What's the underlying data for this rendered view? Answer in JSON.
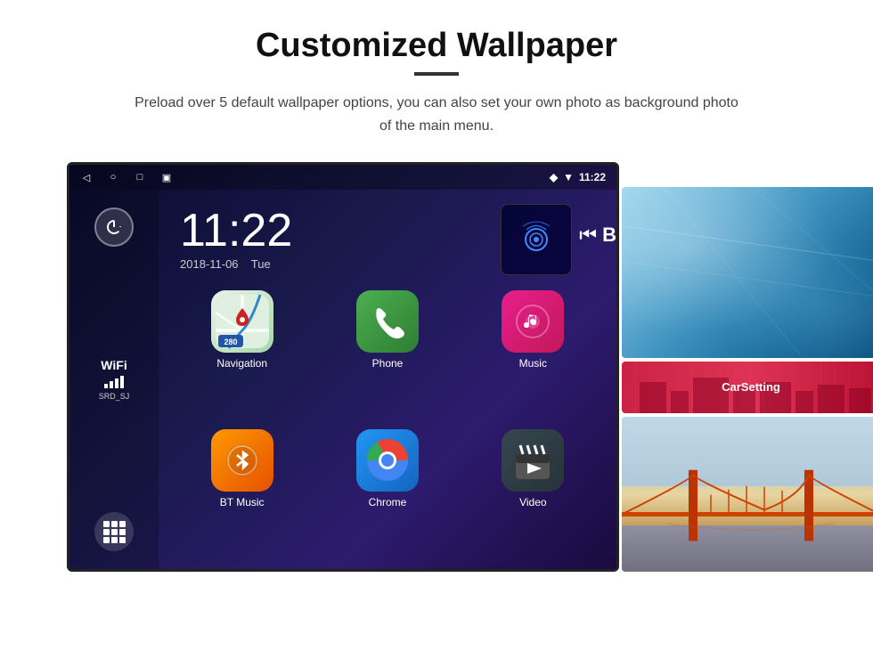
{
  "header": {
    "title": "Customized Wallpaper",
    "subtitle": "Preload over 5 default wallpaper options, you can also set your own photo as background photo of the main menu."
  },
  "status_bar": {
    "time": "11:22",
    "wifi_icon": "wifi",
    "nav_icon": "location"
  },
  "clock": {
    "time": "11:22",
    "date": "2018-11-06",
    "day": "Tue"
  },
  "wifi": {
    "label": "WiFi",
    "ssid": "SRD_SJ"
  },
  "apps": [
    {
      "name": "Navigation",
      "label": "Navigation",
      "type": "navigation"
    },
    {
      "name": "Phone",
      "label": "Phone",
      "type": "phone"
    },
    {
      "name": "Music",
      "label": "Music",
      "type": "music"
    },
    {
      "name": "BT Music",
      "label": "BT Music",
      "type": "btmusic"
    },
    {
      "name": "Chrome",
      "label": "Chrome",
      "type": "chrome"
    },
    {
      "name": "Video",
      "label": "Video",
      "type": "video"
    }
  ],
  "carsetting": {
    "label": "CarSetting"
  },
  "wallpapers": {
    "top_label": "Ice Landscape",
    "bottom_label": "Bridge",
    "middle_label": "CarSetting"
  }
}
